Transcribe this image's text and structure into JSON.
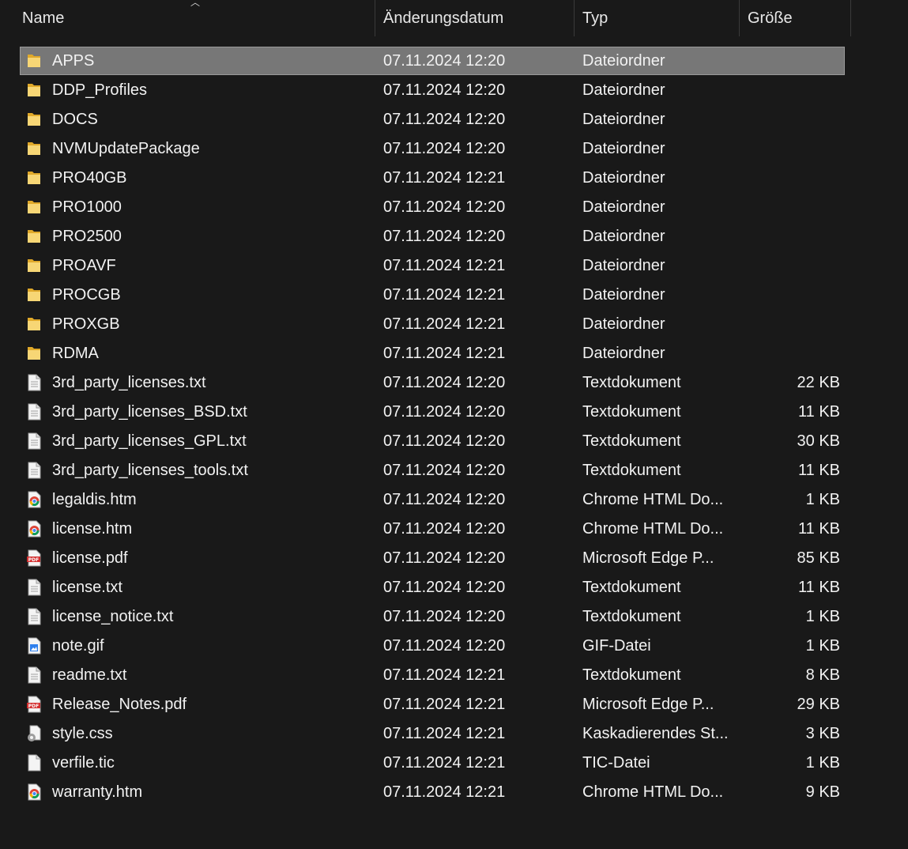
{
  "columns": {
    "name": "Name",
    "date": "Änderungsdatum",
    "type": "Typ",
    "size": "Größe"
  },
  "files": [
    {
      "name": "APPS",
      "date": "07.11.2024 12:20",
      "type": "Dateiordner",
      "size": "",
      "icon": "folder-icon",
      "selected": true
    },
    {
      "name": "DDP_Profiles",
      "date": "07.11.2024 12:20",
      "type": "Dateiordner",
      "size": "",
      "icon": "folder-icon"
    },
    {
      "name": "DOCS",
      "date": "07.11.2024 12:20",
      "type": "Dateiordner",
      "size": "",
      "icon": "folder-icon"
    },
    {
      "name": "NVMUpdatePackage",
      "date": "07.11.2024 12:20",
      "type": "Dateiordner",
      "size": "",
      "icon": "folder-icon"
    },
    {
      "name": "PRO40GB",
      "date": "07.11.2024 12:21",
      "type": "Dateiordner",
      "size": "",
      "icon": "folder-icon"
    },
    {
      "name": "PRO1000",
      "date": "07.11.2024 12:20",
      "type": "Dateiordner",
      "size": "",
      "icon": "folder-icon"
    },
    {
      "name": "PRO2500",
      "date": "07.11.2024 12:20",
      "type": "Dateiordner",
      "size": "",
      "icon": "folder-icon"
    },
    {
      "name": "PROAVF",
      "date": "07.11.2024 12:21",
      "type": "Dateiordner",
      "size": "",
      "icon": "folder-icon"
    },
    {
      "name": "PROCGB",
      "date": "07.11.2024 12:21",
      "type": "Dateiordner",
      "size": "",
      "icon": "folder-icon"
    },
    {
      "name": "PROXGB",
      "date": "07.11.2024 12:21",
      "type": "Dateiordner",
      "size": "",
      "icon": "folder-icon"
    },
    {
      "name": "RDMA",
      "date": "07.11.2024 12:21",
      "type": "Dateiordner",
      "size": "",
      "icon": "folder-icon"
    },
    {
      "name": "3rd_party_licenses.txt",
      "date": "07.11.2024 12:20",
      "type": "Textdokument",
      "size": "22 KB",
      "icon": "text-file-icon"
    },
    {
      "name": "3rd_party_licenses_BSD.txt",
      "date": "07.11.2024 12:20",
      "type": "Textdokument",
      "size": "11 KB",
      "icon": "text-file-icon"
    },
    {
      "name": "3rd_party_licenses_GPL.txt",
      "date": "07.11.2024 12:20",
      "type": "Textdokument",
      "size": "30 KB",
      "icon": "text-file-icon"
    },
    {
      "name": "3rd_party_licenses_tools.txt",
      "date": "07.11.2024 12:20",
      "type": "Textdokument",
      "size": "11 KB",
      "icon": "text-file-icon"
    },
    {
      "name": "legaldis.htm",
      "date": "07.11.2024 12:20",
      "type": "Chrome HTML Do...",
      "size": "1 KB",
      "icon": "chrome-html-icon"
    },
    {
      "name": "license.htm",
      "date": "07.11.2024 12:20",
      "type": "Chrome HTML Do...",
      "size": "11 KB",
      "icon": "chrome-html-icon"
    },
    {
      "name": "license.pdf",
      "date": "07.11.2024 12:20",
      "type": "Microsoft Edge P...",
      "size": "85 KB",
      "icon": "pdf-icon"
    },
    {
      "name": "license.txt",
      "date": "07.11.2024 12:20",
      "type": "Textdokument",
      "size": "11 KB",
      "icon": "text-file-icon"
    },
    {
      "name": "license_notice.txt",
      "date": "07.11.2024 12:20",
      "type": "Textdokument",
      "size": "1 KB",
      "icon": "text-file-icon"
    },
    {
      "name": "note.gif",
      "date": "07.11.2024 12:20",
      "type": "GIF-Datei",
      "size": "1 KB",
      "icon": "image-file-icon"
    },
    {
      "name": "readme.txt",
      "date": "07.11.2024 12:21",
      "type": "Textdokument",
      "size": "8 KB",
      "icon": "text-file-icon"
    },
    {
      "name": "Release_Notes.pdf",
      "date": "07.11.2024 12:21",
      "type": "Microsoft Edge P...",
      "size": "29 KB",
      "icon": "pdf-icon"
    },
    {
      "name": "style.css",
      "date": "07.11.2024 12:21",
      "type": "Kaskadierendes St...",
      "size": "3 KB",
      "icon": "css-file-icon"
    },
    {
      "name": "verfile.tic",
      "date": "07.11.2024 12:21",
      "type": "TIC-Datei",
      "size": "1 KB",
      "icon": "blank-file-icon"
    },
    {
      "name": "warranty.htm",
      "date": "07.11.2024 12:21",
      "type": "Chrome HTML Do...",
      "size": "9 KB",
      "icon": "chrome-html-icon"
    }
  ],
  "colors": {
    "background": "#191919",
    "selection": "#777777",
    "folder": "#f2c94c",
    "pdf_red": "#d32f2f"
  }
}
